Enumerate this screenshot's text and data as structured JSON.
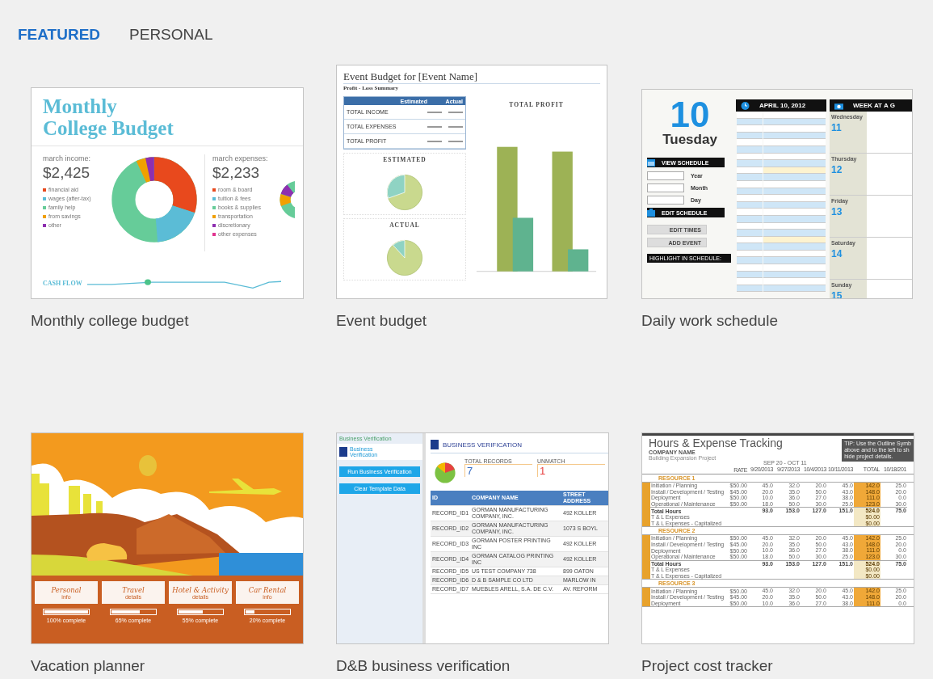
{
  "tabs": [
    {
      "label": "FEATURED",
      "selected": true
    },
    {
      "label": "PERSONAL",
      "selected": false
    }
  ],
  "templates": [
    {
      "name": "Monthly college budget",
      "kind": "budget",
      "preview": {
        "title_lines": [
          "Monthly",
          "College Budget"
        ],
        "income_label": "march income:",
        "income": "$2,425",
        "income_legend": [
          {
            "label": "financial aid",
            "color": "#e8491d"
          },
          {
            "label": "wages (after-tax)",
            "color": "#5bbcd6"
          },
          {
            "label": "family help",
            "color": "#66cc99"
          },
          {
            "label": "from savings",
            "color": "#f0a000"
          },
          {
            "label": "other",
            "color": "#8e2fb0"
          }
        ],
        "expense_label": "march expenses:",
        "expense": "$2,233",
        "expense_legend": [
          {
            "label": "room & board",
            "color": "#e8491d"
          },
          {
            "label": "tuition & fees",
            "color": "#5bbcd6"
          },
          {
            "label": "books & supplies",
            "color": "#66cc99"
          },
          {
            "label": "transportation",
            "color": "#f0a000"
          },
          {
            "label": "discretionary",
            "color": "#8e2fb0"
          },
          {
            "label": "other expenses",
            "color": "#e0338f"
          }
        ],
        "cash_flow": "CASH FLOW"
      }
    },
    {
      "name": "Event budget",
      "kind": "event",
      "preview": {
        "title": "Event Budget for [Event Name]",
        "subtitle": "Profit - Loss Summary",
        "columns": [
          "Estimated",
          "Actual"
        ],
        "rows": [
          "TOTAL INCOME",
          "TOTAL EXPENSES",
          "TOTAL PROFIT"
        ],
        "pie_titles": [
          "ESTIMATED",
          "ACTUAL"
        ],
        "bar_title": "TOTAL PROFIT"
      }
    },
    {
      "name": "Daily work schedule",
      "kind": "schedule",
      "preview": {
        "day_number": "10",
        "weekday": "Tuesday",
        "view_schedule": "VIEW SCHEDULE",
        "fields": [
          "Year",
          "Month",
          "Day"
        ],
        "edit_schedule": "EDIT SCHEDULE",
        "buttons": [
          "EDIT TIMES",
          "ADD EVENT"
        ],
        "highlight": "HIGHLIGHT IN SCHEDULE:",
        "date_header": "APRIL 10, 2012",
        "week_header": "WEEK AT A G",
        "days": [
          {
            "name": "Wednesday",
            "number": "11"
          },
          {
            "name": "Thursday",
            "number": "12"
          },
          {
            "name": "Friday",
            "number": "13"
          },
          {
            "name": "Saturday",
            "number": "14"
          },
          {
            "name": "Sunday",
            "number": "15"
          }
        ]
      }
    },
    {
      "name": "Vacation planner",
      "kind": "vacation",
      "preview": {
        "cards": [
          {
            "title": "Personal",
            "sub": "info",
            "level": 1,
            "caption": "100% complete"
          },
          {
            "title": "Travel",
            "sub": "details",
            "level": 0.65,
            "caption": "65% complete"
          },
          {
            "title": "Hotel & Activity",
            "sub": "details",
            "level": 0.55,
            "caption": "55% complete"
          },
          {
            "title": "Car Rental",
            "sub": "info",
            "level": 0.2,
            "caption": "20% complete"
          }
        ]
      }
    },
    {
      "name": "D&B business verification",
      "kind": "verification",
      "preview": {
        "pane_title": "Business Verification",
        "logo_lines": [
          "Business",
          "Verification"
        ],
        "buttons": [
          "Run Business Verification",
          "Clear Template Data"
        ],
        "title": "BUSINESS VERIFICATION",
        "stats": [
          {
            "label": "TOTAL RECORDS",
            "value": "7",
            "color": "#3a6fc4"
          },
          {
            "label": "UNMATCH",
            "value": "1",
            "color": "#e84040"
          }
        ],
        "columns": [
          "ID",
          "COMPANY NAME",
          "STREET ADDRESS"
        ],
        "rows": [
          [
            "RECORD_ID1",
            "GORMAN MANUFACTURING COMPANY, INC.",
            "492 KOLLER"
          ],
          [
            "RECORD_ID2",
            "GORMAN MANUFACTURING COMPANY, INC.",
            "1073 S BOYL"
          ],
          [
            "RECORD_ID3",
            "GORMAN POSTER PRINTING INC",
            "492 KOLLER"
          ],
          [
            "RECORD_ID4",
            "GORMAN CATALOG PRINTING INC",
            "492 KOLLER"
          ],
          [
            "RECORD_ID5",
            "US TEST COMPANY 738",
            "899 OATON"
          ],
          [
            "RECORD_ID6",
            "D & B SAMPLE CO LTD",
            "MARLOW IN"
          ],
          [
            "RECORD_ID7",
            "MUEBLES ARELL, S.A. DE C.V.",
            "AV. REFORM"
          ]
        ]
      }
    },
    {
      "name": "Project cost tracker",
      "kind": "tracker",
      "preview": {
        "title": "Hours & Expense Tracking",
        "company": "COMPANY NAME",
        "project": "Building Expansion Project",
        "tip_lines": [
          "TIP: Use the Outline Symb",
          "above and to the left to sh",
          "hide project details."
        ],
        "period": "SEP 20 - OCT 11",
        "columns": [
          "RATE",
          "9/20/2013",
          "9/27/2013",
          "10/4/2013",
          "10/11/2013",
          "TOTAL",
          "10/18/201"
        ],
        "resources": [
          {
            "name": "RESOURCE 1",
            "rows": [
              {
                "label": "Initiation / Planning",
                "rate": "$50.00",
                "hours": [
                  "45.0",
                  "32.0",
                  "20.0",
                  "45.0"
                ],
                "total": "142.0",
                "next": "25.0"
              },
              {
                "label": "Install / Development / Testing",
                "rate": "$45.00",
                "hours": [
                  "20.0",
                  "35.0",
                  "50.0",
                  "43.0"
                ],
                "total": "148.0",
                "next": "20.0"
              },
              {
                "label": "Deployment",
                "rate": "$50.00",
                "hours": [
                  "10.0",
                  "36.0",
                  "27.0",
                  "38.0"
                ],
                "total": "111.0",
                "next": "0.0"
              },
              {
                "label": "Operational / Maintenance",
                "rate": "$50.00",
                "hours": [
                  "18.0",
                  "50.0",
                  "30.0",
                  "25.0"
                ],
                "total": "123.0",
                "next": "30.0"
              }
            ],
            "totals": [
              {
                "label": "Total Hours",
                "hours": [
                  "93.0",
                  "153.0",
                  "127.0",
                  "151.0"
                ],
                "total": "524.0",
                "next": "75.0"
              },
              {
                "label": "T & L Expenses",
                "total": "$0.00"
              },
              {
                "label": "T & L Expenses - Capitalized",
                "total": "$0.00"
              }
            ]
          },
          {
            "name": "RESOURCE 2",
            "rows": [
              {
                "label": "Initiation / Planning",
                "rate": "$50.00",
                "hours": [
                  "45.0",
                  "32.0",
                  "20.0",
                  "45.0"
                ],
                "total": "142.0",
                "next": "25.0"
              },
              {
                "label": "Install / Development / Testing",
                "rate": "$45.00",
                "hours": [
                  "20.0",
                  "35.0",
                  "50.0",
                  "43.0"
                ],
                "total": "148.0",
                "next": "20.0"
              },
              {
                "label": "Deployment",
                "rate": "$50.00",
                "hours": [
                  "10.0",
                  "36.0",
                  "27.0",
                  "38.0"
                ],
                "total": "111.0",
                "next": "0.0"
              },
              {
                "label": "Operational / Maintenance",
                "rate": "$50.00",
                "hours": [
                  "18.0",
                  "50.0",
                  "30.0",
                  "25.0"
                ],
                "total": "123.0",
                "next": "30.0"
              }
            ],
            "totals": [
              {
                "label": "Total Hours",
                "hours": [
                  "93.0",
                  "153.0",
                  "127.0",
                  "151.0"
                ],
                "total": "524.0",
                "next": "75.0"
              },
              {
                "label": "T & L Expenses",
                "total": "$0.00"
              },
              {
                "label": "T & L Expenses - Capitalized",
                "total": "$0.00"
              }
            ]
          },
          {
            "name": "RESOURCE 3",
            "rows": [
              {
                "label": "Initiation / Planning",
                "rate": "$50.00",
                "hours": [
                  "45.0",
                  "32.0",
                  "20.0",
                  "45.0"
                ],
                "total": "142.0",
                "next": "25.0"
              },
              {
                "label": "Install / Development / Testing",
                "rate": "$45.00",
                "hours": [
                  "20.0",
                  "35.0",
                  "50.0",
                  "43.0"
                ],
                "total": "148.0",
                "next": "20.0"
              },
              {
                "label": "Deployment",
                "rate": "$50.00",
                "hours": [
                  "10.0",
                  "36.0",
                  "27.0",
                  "38.0"
                ],
                "total": "111.0",
                "next": "0.0"
              }
            ]
          }
        ]
      }
    }
  ]
}
